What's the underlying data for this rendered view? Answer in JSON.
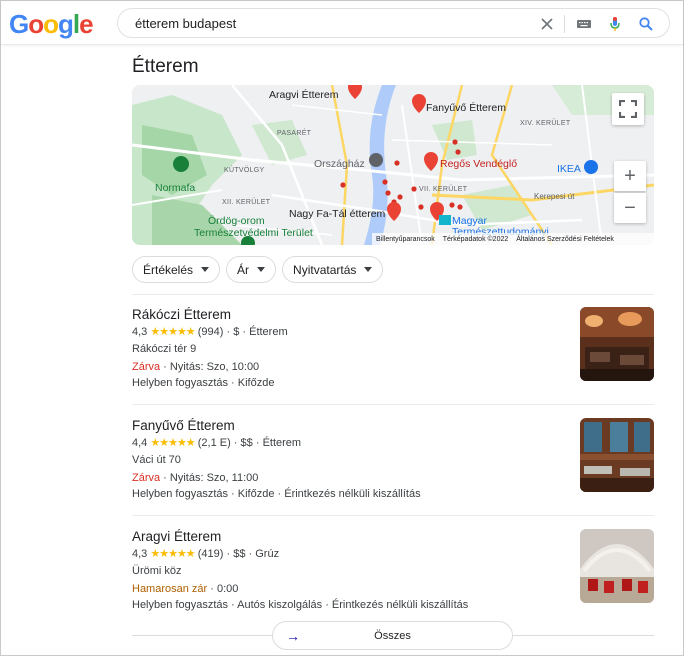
{
  "logo": [
    "G",
    "o",
    "o",
    "g",
    "l",
    "e"
  ],
  "search": {
    "query": "étterem budapest"
  },
  "title": "Étterem",
  "map": {
    "labels": {
      "aragvi": "Aragvi Étterem",
      "fanyuvo": "Fanyűvő Étterem",
      "pasaret": "PASARÉT",
      "kerulet13": "XIV. KERÜLET",
      "orszaghaz": "Országház",
      "regos": "Regős Vendéglő",
      "kutvolgy": "KÚTVÖLGY",
      "normafa": "Normafa",
      "ikea": "IKEA",
      "kerulet12": "XII. KERÜLET",
      "kerulet7": "VII. KERÜLET",
      "kerepesi": "Kerepesi út",
      "ordog1": "Ördög-orom",
      "ordog2": "Természetvédelmi Terület",
      "nagyfatal": "Nagy Fa-Tál étterem",
      "magyar1": "Magyar",
      "magyar2": "Természettudományi"
    },
    "footer": {
      "shortcuts": "Billentyűparancsok",
      "mapdata": "Térképadatok ©2022",
      "terms": "Általános Szerződési Feltételek"
    },
    "zoom_in": "+",
    "zoom_out": "−"
  },
  "filters": [
    "Értékelés",
    "Ár",
    "Nyitvatartás"
  ],
  "results": [
    {
      "name": "Rákóczi Étterem",
      "rating": "4,3",
      "stars": "★★★★★",
      "reviews": "(994)",
      "price": "$",
      "category": "Étterem",
      "address": "Rákóczi tér 9",
      "status": "Zárva",
      "hours": "Nyitás: Szo, 10:00",
      "services": "Helyben fogyasztás · Kifőzde"
    },
    {
      "name": "Fanyűvő Étterem",
      "rating": "4,4",
      "stars": "★★★★★",
      "reviews": "(2,1 E)",
      "price": "$$",
      "category": "Étterem",
      "address": "Váci út 70",
      "status": "Zárva",
      "hours": "Nyitás: Szo, 11:00",
      "services": "Helyben fogyasztás · Kifőzde · Érintkezés nélküli kiszállítás"
    },
    {
      "name": "Aragvi Étterem",
      "rating": "4,3",
      "stars": "★★★★★",
      "reviews": "(419)",
      "price": "$$",
      "category": "Grúz",
      "address": "Ürömi köz",
      "status": "Hamarosan zár",
      "hours": "0:00",
      "services": "Helyben fogyasztás · Autós kiszolgálás · Érintkezés nélküli kiszállítás"
    }
  ],
  "all_button": "Összes",
  "colors": {
    "closed": "#d93025",
    "closing": "#b06000",
    "stars": "#fbbc04"
  }
}
